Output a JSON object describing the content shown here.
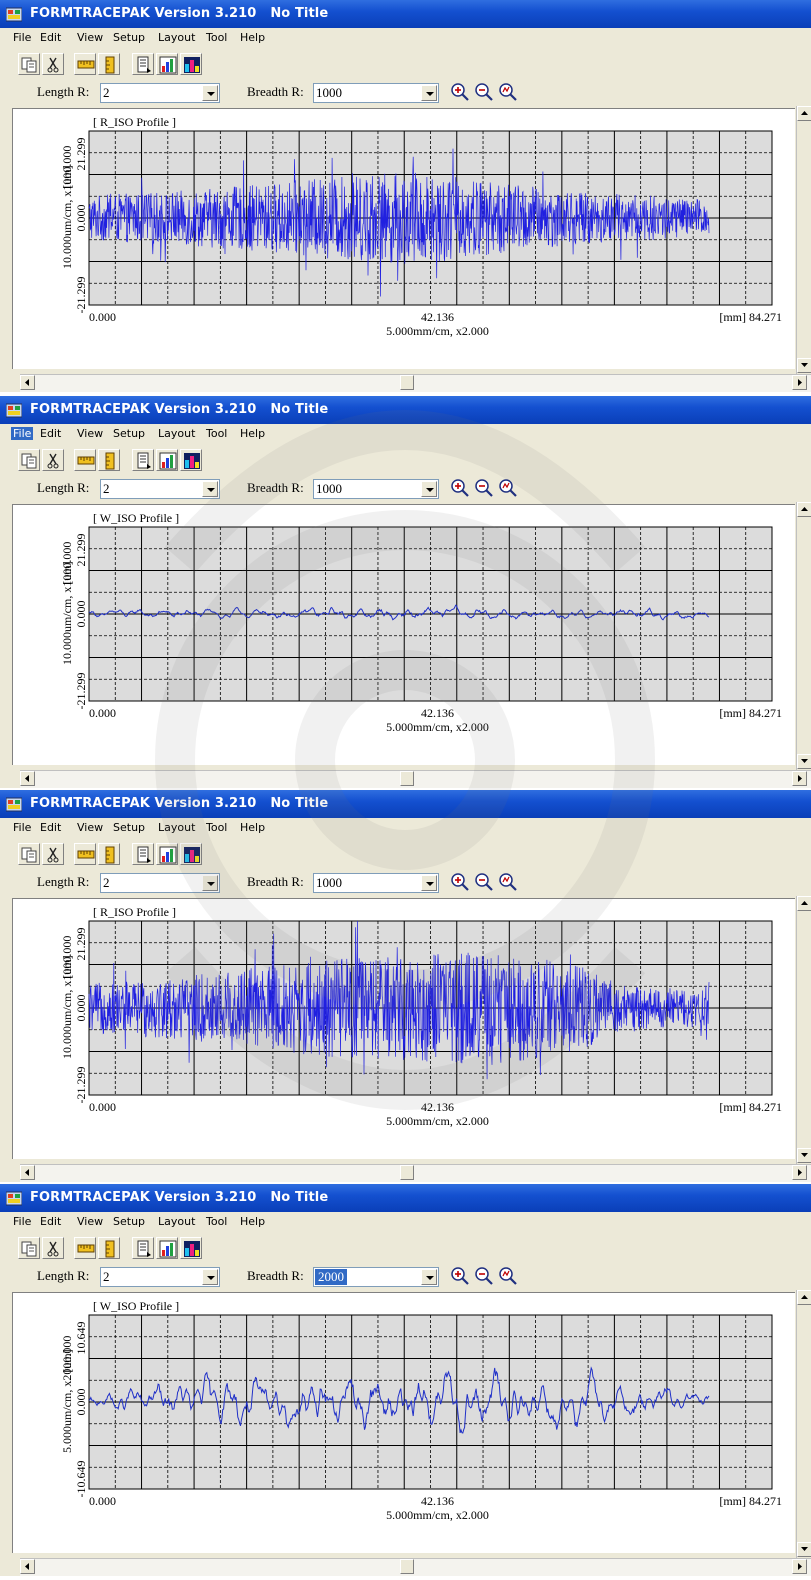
{
  "app": {
    "title": "FORMTRACEPAK Version 3.210   No Title",
    "menu": [
      "File",
      "Edit",
      "View",
      "Setup",
      "Layout",
      "Tool",
      "Help"
    ],
    "length_label": "Length R:",
    "breadth_label": "Breadth R:",
    "x_tick_min": "0.000",
    "x_tick_mid": "42.136",
    "x_tick_max": "[mm] 84.271",
    "x_scale": "5.000mm/cm, x2.000"
  },
  "windows": [
    {
      "length_value": "2",
      "breadth_value": "1000",
      "breadth_selected": false,
      "active_menu": "",
      "profile_label": "[ R_ISO Profile ]",
      "y_scale": "10.000um/cm, x1000.000",
      "y_unit": "[um]",
      "y_tick_top": "21.299",
      "y_tick_mid": "0.000",
      "y_tick_bottom": "-21.299",
      "chart_data": {
        "type": "line",
        "profile": "R_ISO",
        "x_range": [
          0.0,
          84.271
        ],
        "ylim": [
          -21.299,
          21.299
        ],
        "visual_amplitude_um": [
          {
            "x": 0,
            "y": 5.5
          },
          {
            "x": 10,
            "y": 6.5
          },
          {
            "x": 20,
            "y": 8.0
          },
          {
            "x": 30,
            "y": 10.0
          },
          {
            "x": 40,
            "y": 11.5
          },
          {
            "x": 50,
            "y": 9.0
          },
          {
            "x": 60,
            "y": 6.5
          },
          {
            "x": 70,
            "y": 5.5
          },
          {
            "x": 76,
            "y": 4.5
          }
        ],
        "trace_end_mm": 76.5,
        "color": "#2020e0",
        "grid": true
      }
    },
    {
      "length_value": "2",
      "breadth_value": "1000",
      "breadth_selected": false,
      "active_menu": "File",
      "profile_label": "[ W_ISO Profile ]",
      "y_scale": "10.000um/cm, x1000.000",
      "y_unit": "[um]",
      "y_tick_top": "21.299",
      "y_tick_mid": "0.000",
      "y_tick_bottom": "-21.299",
      "chart_data": {
        "type": "line",
        "profile": "W_ISO",
        "x_range": [
          0.0,
          84.271
        ],
        "ylim": [
          -21.299,
          21.299
        ],
        "visual_amplitude_um": [
          {
            "x": 0,
            "y": 0.8
          },
          {
            "x": 10,
            "y": 1.0
          },
          {
            "x": 20,
            "y": 1.0
          },
          {
            "x": 30,
            "y": 1.2
          },
          {
            "x": 40,
            "y": 1.4
          },
          {
            "x": 50,
            "y": 1.2
          },
          {
            "x": 60,
            "y": 1.0
          },
          {
            "x": 70,
            "y": 1.2
          },
          {
            "x": 76,
            "y": 0.8
          }
        ],
        "trace_end_mm": 76.5,
        "color": "#2030c8",
        "grid": true
      }
    },
    {
      "length_value": "2",
      "breadth_value": "1000",
      "breadth_selected": false,
      "active_menu": "",
      "profile_label": "[ R_ISO Profile ]",
      "y_scale": "10.000um/cm, x1000.000",
      "y_unit": "[um]",
      "y_tick_top": "21.299",
      "y_tick_mid": "0.000",
      "y_tick_bottom": "-21.299",
      "chart_data": {
        "type": "line",
        "profile": "R_ISO",
        "x_range": [
          0.0,
          84.271
        ],
        "ylim": [
          -21.299,
          21.299
        ],
        "visual_amplitude_um": [
          {
            "x": 0,
            "y": 6.0
          },
          {
            "x": 10,
            "y": 7.5
          },
          {
            "x": 20,
            "y": 10.0
          },
          {
            "x": 30,
            "y": 12.0
          },
          {
            "x": 40,
            "y": 13.0
          },
          {
            "x": 50,
            "y": 14.0
          },
          {
            "x": 60,
            "y": 11.0
          },
          {
            "x": 66,
            "y": 5.5
          },
          {
            "x": 76,
            "y": 4.5
          }
        ],
        "trace_end_mm": 76.5,
        "color": "#2020e0",
        "grid": true
      }
    },
    {
      "length_value": "2",
      "breadth_value": "2000",
      "breadth_selected": true,
      "active_menu": "",
      "profile_label": "[ W_ISO Profile ]",
      "y_scale": "5.000um/cm, x2000.000",
      "y_unit": "[um]",
      "y_tick_top": "10.649",
      "y_tick_mid": "0.000",
      "y_tick_bottom": "-10.649",
      "chart_data": {
        "type": "line",
        "profile": "W_ISO",
        "x_range": [
          0.0,
          84.271
        ],
        "ylim": [
          -10.649,
          10.649
        ],
        "visual_amplitude_um": [
          {
            "x": 0,
            "y": 0.8
          },
          {
            "x": 10,
            "y": 2.0
          },
          {
            "x": 20,
            "y": 2.5
          },
          {
            "x": 30,
            "y": 3.0
          },
          {
            "x": 40,
            "y": 3.0
          },
          {
            "x": 50,
            "y": 3.0
          },
          {
            "x": 60,
            "y": 2.5
          },
          {
            "x": 70,
            "y": 1.5
          },
          {
            "x": 76,
            "y": 1.0
          }
        ],
        "trace_end_mm": 76.5,
        "color": "#2030c8",
        "grid": true
      }
    }
  ],
  "colors": {
    "titlebar": "#0a3fb8",
    "chrome": "#ece9d8",
    "plot_bg": "#dcdcdc",
    "grid_major": "#000000",
    "selection": "#316ac5"
  },
  "icons": [
    "app-icon",
    "copy-icon",
    "cut-icon",
    "ruler-icon",
    "column-icon",
    "list-icon",
    "chart-icon",
    "colorbars-icon",
    "zoom-in-icon",
    "zoom-out-icon",
    "zoom-fit-icon"
  ]
}
